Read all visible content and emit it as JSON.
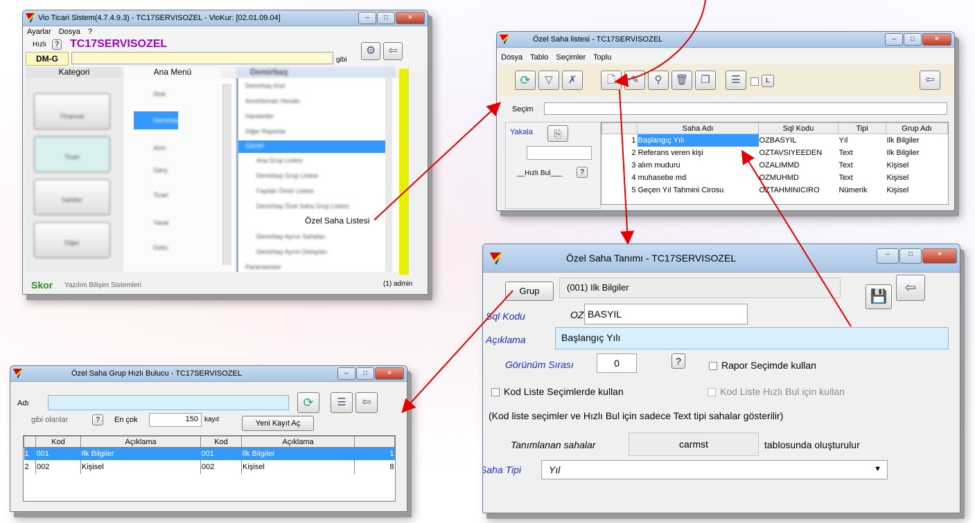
{
  "main_window": {
    "title": "Vio Ticari Sistem(4.7.4.9.3) - TC17SERVISOZEL - VioKur: [02.01.09.04]",
    "menu": [
      "Ayarlar",
      "Dosya",
      "?"
    ],
    "hizli_label": "Hızlı",
    "help_glyph": "?",
    "company": "TC17SERVISOZEL",
    "code": "DM-G",
    "gibi": "gibi",
    "col_kategori": "Kategori",
    "col_ana_menu": "Ana Menü",
    "col_tree_header": "Demirbaş",
    "categories": [
      "Finansal",
      "Ticari",
      "Sabitler",
      "Diğer"
    ],
    "ana_menu_items": [
      "Stok",
      "Demirbaş",
      "Alım",
      "Satış",
      "Ticari",
      "Yasal",
      "Dokü"
    ],
    "tree_items": [
      "Demirbaş Kod",
      "Amortisman Hesabı",
      "Hareketler",
      "Diğer Raporlar",
      "Genel",
      "Ana Grup Listesi",
      "Demirbaş Grup Listesi",
      "Faydalı Ömür Listesi",
      "Demirbaş Özel Saha Grup Listesi",
      "Özel Saha Listesi",
      "Demirbaş Ayrım Sahaları",
      "Demirbaş Ayrım Detayları",
      "Parametreler"
    ],
    "footer_brand": "Skor",
    "footer_text": "Yazılım Bilişim Sistemleri",
    "footer_user": "(1) admin"
  },
  "list_window": {
    "title": "Özel Saha listesi - TC17SERVISOZEL",
    "menu": [
      "Dosya",
      "Tablo",
      "Seçimler",
      "Toplu"
    ],
    "secim_label": "Seçim",
    "yakala_label": "Yakala",
    "hizli_bul_label": "__Hızlı Bul___",
    "help_glyph": "?",
    "columns": [
      "",
      "Saha Adı",
      "Sql Kodu",
      "Tipi",
      "Grup Adı"
    ],
    "rows": [
      [
        "1",
        "Başlangıç Yılı",
        "OZBASYIL",
        "Yıl",
        "Ilk Bilgiler"
      ],
      [
        "2",
        "Referans veren kişi",
        "OZTAVSIYEEDEN",
        "Text",
        "Ilk Bilgiler"
      ],
      [
        "3",
        "alım muduru",
        "OZALIMMD",
        "Text",
        "Kişisel"
      ],
      [
        "4",
        "muhasebe md",
        "OZMUHMD",
        "Text",
        "Kişisel"
      ],
      [
        "5",
        "Geçen Yıl Tahmini Cirosu",
        "OZTAHMINICIRO",
        "Nümerik",
        "Kişisel"
      ]
    ],
    "l_label": "L"
  },
  "group_window": {
    "title": "Özel Saha Grup Hızlı Bulucu - TC17SERVISOZEL",
    "adi_label": "Adı",
    "gibi_olanlar": "gibi olanlar",
    "help_glyph": "?",
    "en_cok": "En çok",
    "count": "150",
    "kayit": "kayıt",
    "yeni_kayit": "Yeni Kayıt Aç",
    "columns": [
      "",
      "Kod",
      "Açıklama",
      "Kod",
      "Açıklama",
      ""
    ],
    "rows": [
      [
        "1",
        "001",
        "Ilk Bilgiler",
        "001",
        "Ilk Bilgiler",
        "1"
      ],
      [
        "2",
        "002",
        "Kişisel",
        "002",
        "Kişisel",
        "8"
      ]
    ]
  },
  "def_window": {
    "title": "Özel Saha Tanımı - TC17SERVISOZEL",
    "grup_btn": "Grup",
    "grup_value": "(001) Ilk Bilgiler",
    "sql_kodu_label": "Sql Kodu",
    "sql_prefix": "OZ",
    "sql_value": "BASYIL",
    "aciklama_label": "Açıklama",
    "aciklama_value": "Başlangıç Yılı",
    "gorunum_label": "Görünüm Sırası",
    "gorunum_value": "0",
    "help_glyph": "?",
    "rapor_secim": "Rapor Seçimde kullan",
    "kod_liste_secim": "Kod Liste Seçimlerde kullan",
    "kod_liste_hizli": "Kod Liste Hızlı Bul için kullan",
    "note": "(Kod liste seçimler ve Hızlı Bul için sadece Text tipi sahalar gösterilir)",
    "tanimlanan": "Tanımlanan sahalar",
    "table_name": "carmst",
    "tablosunda": "tablosunda oluşturulur",
    "saha_tipi_label": "Saha Tipi",
    "saha_tipi_value": "Yıl"
  },
  "colors": {
    "selection": "#3399ff",
    "arrow": "#e00000",
    "company": "#a000c0",
    "label_blue": "#1a2bd0"
  }
}
